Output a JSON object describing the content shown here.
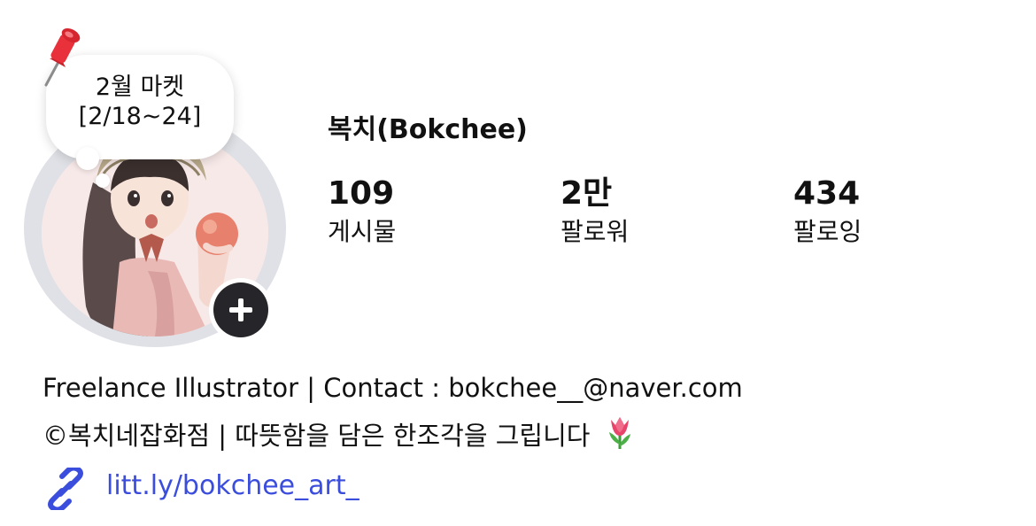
{
  "note": {
    "line1": "2월 마켓",
    "line2": "[2/18~24]"
  },
  "profile": {
    "username": "복치(Bokchee)",
    "stats": [
      {
        "value": "109",
        "label": "게시물"
      },
      {
        "value": "2만",
        "label": "팔로워"
      },
      {
        "value": "434",
        "label": "팔로잉"
      }
    ]
  },
  "bio": {
    "line1": "Freelance Illustrator | Contact : bokchee__@naver.com",
    "line2": "©복치네잡화점 | 따뜻함을 담은 한조각을 그립니다"
  },
  "link": {
    "text": "litt.ly/bokchee_art_"
  },
  "icons": {
    "note": "pushpin-icon",
    "add": "plus-icon",
    "link": "link-icon",
    "bio_emoji": "tulip-icon"
  },
  "colors": {
    "link": "#3b4ddc",
    "add_button": "#26262a",
    "avatar_ring": "#dfe1e6"
  }
}
